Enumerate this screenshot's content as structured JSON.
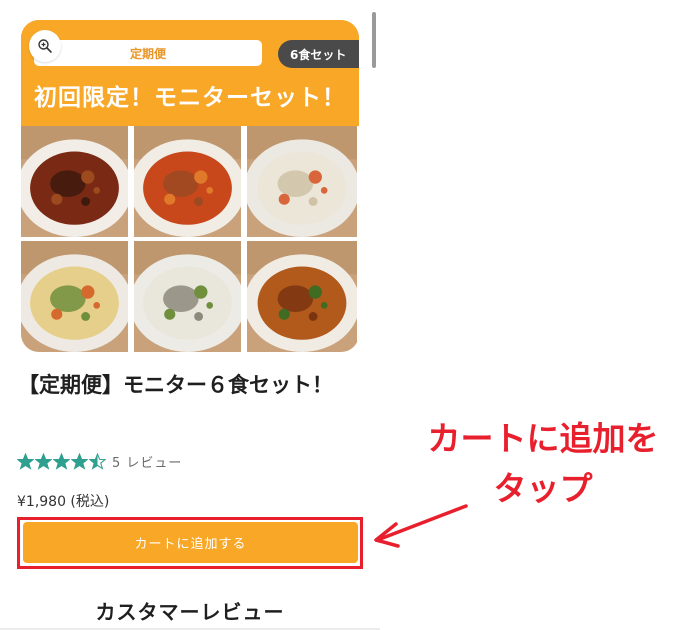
{
  "product_card": {
    "plan_label": "定期便",
    "count_label": "6食セット",
    "banner_title": "初回限定！モニターセット！",
    "photos": [
      {
        "name": "beef-stew-photo",
        "plate": "#f2ede6",
        "sauce": "#7a2a14",
        "accent": "#3e1a0e",
        "bits": "#9c4a1e"
      },
      {
        "name": "hamburg-steak-photo",
        "plate": "#f1ece4",
        "sauce": "#c8481c",
        "accent": "#9b4a22",
        "bits": "#e07a2a"
      },
      {
        "name": "cream-stew-photo",
        "plate": "#ece9e3",
        "sauce": "#ece6d8",
        "accent": "#cfc2a6",
        "bits": "#d8663a"
      },
      {
        "name": "gratin-photo",
        "plate": "#eeeae3",
        "sauce": "#e6cf8a",
        "accent": "#6f8f3c",
        "bits": "#d46a2e"
      },
      {
        "name": "oyster-chowder-photo",
        "plate": "#ecebe6",
        "sauce": "#e9e6dc",
        "accent": "#8d8a7c",
        "bits": "#6f8f3c"
      },
      {
        "name": "keema-curry-photo",
        "plate": "#f0ebe3",
        "sauce": "#b25a1c",
        "accent": "#7a3410",
        "bits": "#3f6b23"
      }
    ],
    "zoom_icon": "zoom-in-icon"
  },
  "product": {
    "title": "【定期便】モニター６食セット！",
    "rating": 4.5,
    "rating_max": 5,
    "review_text": "5 レビュー",
    "price": "¥1,980 (税込)",
    "cart_button_label": "カートに追加する"
  },
  "section": {
    "heading": "カスタマーレビュー"
  },
  "annotation": {
    "line1": "カートに追加を",
    "line2": "タップ"
  },
  "colors": {
    "brand_orange": "#f9a727",
    "star_teal": "#2f9f8f",
    "highlight_red": "#e8202d"
  }
}
